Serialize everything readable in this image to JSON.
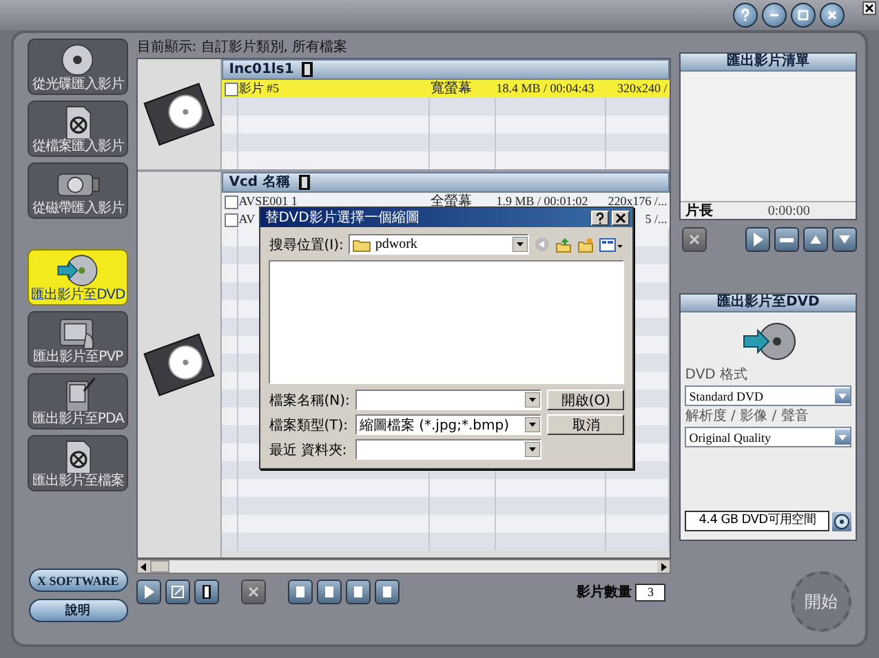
{
  "sidebar": {
    "items": [
      {
        "label": "從光碟匯入影片",
        "kind": "disc-import",
        "selected": false
      },
      {
        "label": "從檔案匯入影片",
        "kind": "file-import",
        "selected": false
      },
      {
        "label": "從磁帶匯入影片",
        "kind": "tape-import",
        "selected": false
      },
      {
        "label": "匯出影片至DVD",
        "kind": "dvd-export",
        "selected": true
      },
      {
        "label": "匯出影片至PVP",
        "kind": "pvp-export",
        "selected": false
      },
      {
        "label": "匯出影片至PDA",
        "kind": "pda-export",
        "selected": false
      },
      {
        "label": "匯出影片至檔案",
        "kind": "file-export",
        "selected": false
      }
    ],
    "buttons": [
      "X SOFTWARE",
      "說明"
    ]
  },
  "view_caption": "目前顯示: 自訂影片類別, 所有檔案",
  "groups": [
    {
      "title": "Inc01ls1",
      "rows": [
        {
          "name": "影片 #5",
          "checked": false,
          "selected": true,
          "column_2": "寬螢幕",
          "column_3": "18.4 MB / 00:04:43",
          "column_4": "320x240 /"
        }
      ]
    },
    {
      "title": "Vcd 名稱",
      "rows": [
        {
          "name": "AVSE001 1",
          "checked": false,
          "selected": false,
          "column_2": "全螢幕",
          "column_3": "1.9 MB / 00:01:02",
          "column_4": "220x176 /..."
        },
        {
          "name": "AV",
          "checked": false,
          "selected": false,
          "column_4": "5 /..."
        }
      ]
    }
  ],
  "toolbar": {
    "buttons": [
      {
        "kind": "play",
        "disabled": false
      },
      {
        "kind": "edit",
        "disabled": false
      },
      {
        "kind": "film",
        "disabled": false
      },
      {
        "kind": "delete",
        "disabled": true
      },
      {
        "kind": "layout",
        "disabled": false
      },
      {
        "kind": "layout",
        "disabled": false
      },
      {
        "kind": "layout",
        "disabled": false
      },
      {
        "kind": "layout",
        "disabled": false
      }
    ],
    "count_label": "影片數量",
    "count": "3"
  },
  "dialog": {
    "title": "替DVD影片選擇一個縮圖",
    "look_in_label": "搜尋位置(I):",
    "look_in": "pdwork",
    "fields": [
      {
        "label": "檔案名稱(N):"
      },
      {
        "label": "檔案類型(T):",
        "value": "縮圖檔案 (*.jpg;*.bmp)"
      },
      {
        "label": "最近 資料夾:"
      }
    ],
    "buttons": [
      "開啟(O)",
      "取消"
    ]
  },
  "export_list": {
    "title": "匯出影片清單",
    "duration_label": "片長",
    "duration": "0:00:00",
    "buttons": [
      {
        "kind": "delete",
        "disabled": true
      },
      {
        "kind": "play",
        "disabled": false
      },
      {
        "kind": "minus",
        "disabled": false
      },
      {
        "kind": "up",
        "disabled": false
      },
      {
        "kind": "down",
        "disabled": false
      }
    ]
  },
  "dvd_panel": {
    "title": "匯出影片至DVD",
    "format_label": "DVD 格式",
    "format": "Standard DVD",
    "quality_label": "解析度 / 影像 / 聲音",
    "quality": "Original Quality",
    "space": "4.4 GB DVD可用空間"
  },
  "start_button": {
    "label": "開始",
    "disabled": true
  }
}
